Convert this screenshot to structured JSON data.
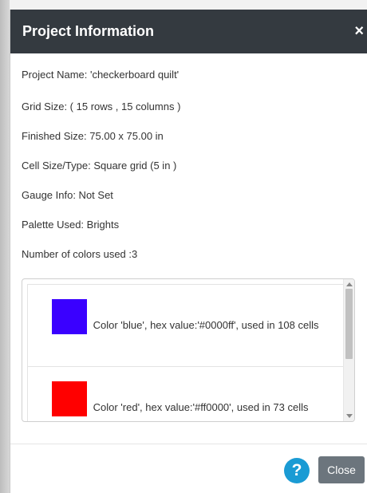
{
  "header": {
    "title": "Project Information",
    "close_glyph": "×"
  },
  "info": [
    "Project Name: 'checkerboard quilt'",
    "Grid Size: ( 15 rows , 15 columns )",
    "Finished Size: 75.00 x 75.00 in",
    "Cell Size/Type: Square grid (5 in )",
    "Gauge Info: Not Set",
    "Palette Used: Brights",
    "Number of colors used :3"
  ],
  "colors": [
    {
      "name": "blue",
      "hex": "#0000ff",
      "swatch_color": "#3a00ff",
      "text": "Color 'blue', hex value:'#0000ff', used in 108 cells"
    },
    {
      "name": "red",
      "hex": "#ff0000",
      "swatch_color": "#ff0000",
      "text": "Color 'red', hex value:'#ff0000', used in 73 cells"
    }
  ],
  "footer": {
    "help_glyph": "?",
    "close_label": "Close"
  }
}
